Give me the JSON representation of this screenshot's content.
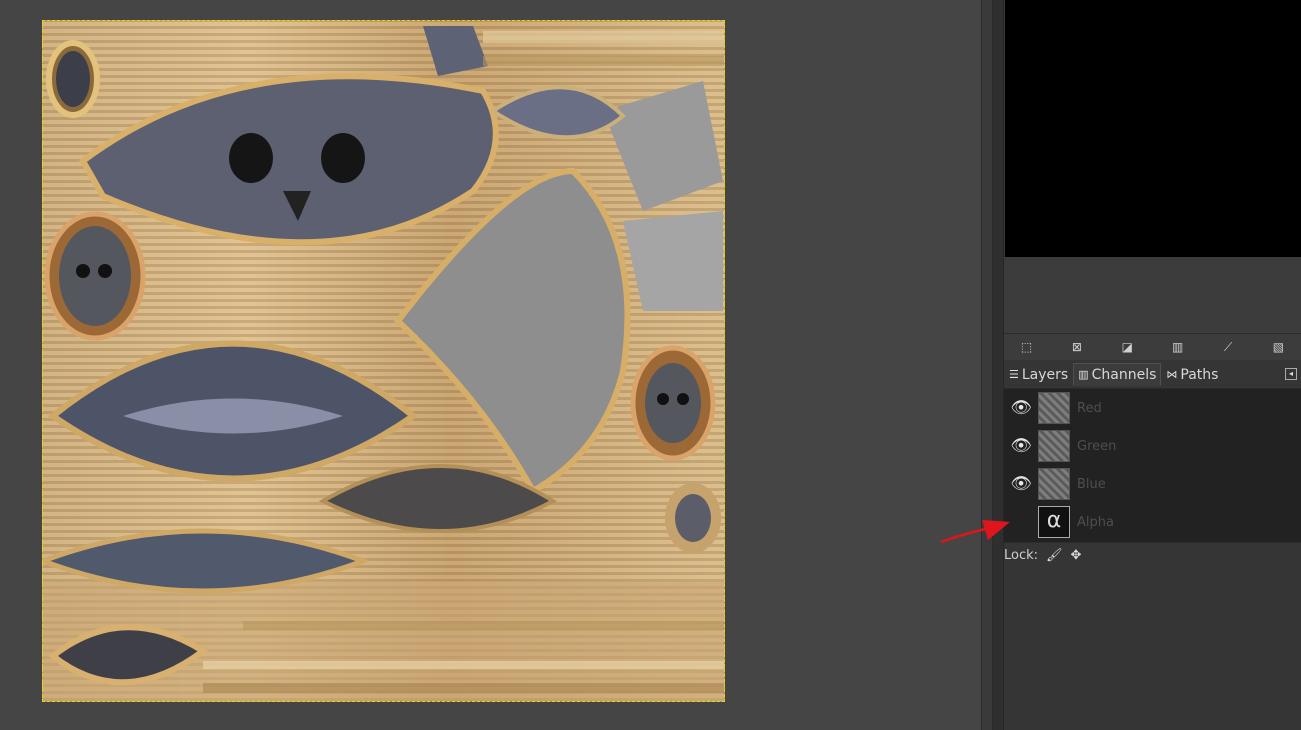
{
  "canvas": {
    "texture_description_icon": "texture-image"
  },
  "dock_toolbar": {
    "icons": [
      "selection-to-channel-icon",
      "delete-channel-icon",
      "edit-channel-icon",
      "duplicate-channel-icon",
      "channel-to-path-icon",
      "new-channel-icon"
    ]
  },
  "tabs": [
    {
      "label": "Layers",
      "icon": "layers-icon",
      "active": false
    },
    {
      "label": "Channels",
      "icon": "channels-icon",
      "active": true
    },
    {
      "label": "Paths",
      "icon": "paths-icon",
      "active": false
    }
  ],
  "channels": [
    {
      "name": "Red",
      "visible": true
    },
    {
      "name": "Green",
      "visible": true
    },
    {
      "name": "Blue",
      "visible": true
    },
    {
      "name": "Alpha",
      "visible": false,
      "thumb_glyph": "α"
    }
  ],
  "lock": {
    "label": "Lock:"
  },
  "colors": {
    "annotation_arrow": "#e0151b",
    "canvas_border": "#e8d800"
  }
}
